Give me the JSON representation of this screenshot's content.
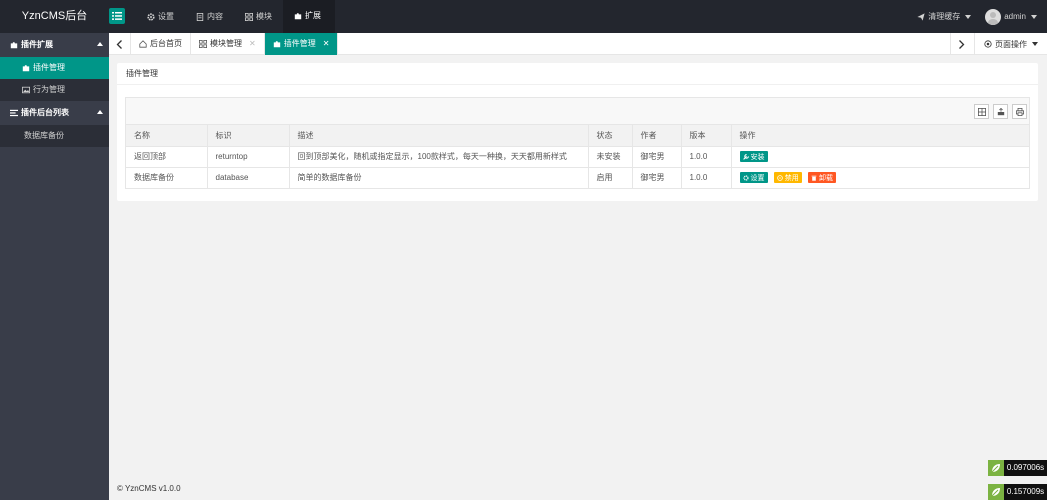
{
  "header": {
    "logo": "YznCMS后台",
    "nav": [
      {
        "label": "设置",
        "icon": "gear-icon"
      },
      {
        "label": "内容",
        "icon": "document-icon"
      },
      {
        "label": "模块",
        "icon": "grid-icon"
      },
      {
        "label": "扩展",
        "icon": "puzzle-icon",
        "active": true
      }
    ],
    "clear_cache": "清理缓存",
    "user": "admin"
  },
  "sidebar": {
    "groups": [
      {
        "label": "插件扩展",
        "items": [
          {
            "label": "插件管理",
            "icon": "puzzle-icon",
            "active": true
          },
          {
            "label": "行为管理",
            "icon": "image-icon"
          }
        ]
      },
      {
        "label": "插件后台列表",
        "items": [
          {
            "label": "数据库备份"
          }
        ]
      }
    ]
  },
  "tabs": [
    {
      "label": "后台首页",
      "icon": "home-icon"
    },
    {
      "label": "模块管理",
      "icon": "grid-icon",
      "closable": true
    },
    {
      "label": "插件管理",
      "icon": "puzzle-icon",
      "closable": true,
      "active": true
    }
  ],
  "page_ops": "页面操作",
  "card": {
    "title": "插件管理",
    "columns": [
      "名称",
      "标识",
      "描述",
      "状态",
      "作者",
      "版本",
      "操作"
    ],
    "rows": [
      {
        "name": "返回顶部",
        "id": "returntop",
        "desc": "回到顶部美化，随机或指定显示，100款样式，每天一种换，天天都用新样式",
        "status": "未安装",
        "author": "御宅男",
        "version": "1.0.0",
        "actions": [
          {
            "label": "安装",
            "color": "#009688"
          }
        ]
      },
      {
        "name": "数据库备份",
        "id": "database",
        "desc": "简单的数据库备份",
        "status": "启用",
        "author": "御宅男",
        "version": "1.0.0",
        "actions": [
          {
            "label": "设置",
            "color": "#009688"
          },
          {
            "label": "禁用",
            "color": "#ffb800"
          },
          {
            "label": "卸载",
            "color": "#ff5722"
          }
        ]
      }
    ]
  },
  "footer": "© YznCMS v1.0.0",
  "debug": [
    "0.097006s",
    "0.157009s"
  ]
}
